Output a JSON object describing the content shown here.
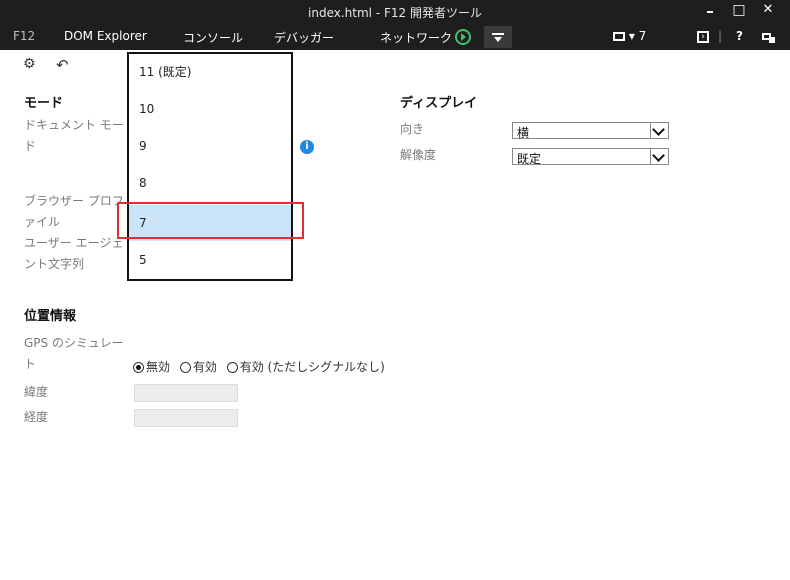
{
  "window": {
    "title": "index.html - F12 開発者ツール",
    "minimize": "–",
    "maximize": "□",
    "close": "✕"
  },
  "tabs": {
    "f12": "F12",
    "dom_explorer": "DOM Explorer",
    "console": "コンソール",
    "debugger": "デバッガー",
    "network": "ネットワーク",
    "emulation_target": "▾ 7",
    "help": "?"
  },
  "mode": {
    "heading": "モード",
    "document_mode_label": "ドキュメント モード",
    "browser_profile_label": "ブラウザー プロファイル",
    "user_agent_label": "ユーザー エージェント文字列"
  },
  "dropdown": {
    "options": [
      "11 (既定)",
      "10",
      "9",
      "8",
      "7",
      "5"
    ],
    "selected": "7"
  },
  "display": {
    "heading": "ディスプレイ",
    "orientation_label": "向き",
    "orientation_value": "横",
    "resolution_label": "解像度",
    "resolution_value": "既定"
  },
  "geolocation": {
    "heading": "位置情報",
    "gps_label": "GPS のシミュレート",
    "options": [
      "無効",
      "有効",
      "有効 (ただしシグナルなし)"
    ],
    "selected_option": "無効",
    "latitude_label": "緯度",
    "longitude_label": "経度"
  }
}
